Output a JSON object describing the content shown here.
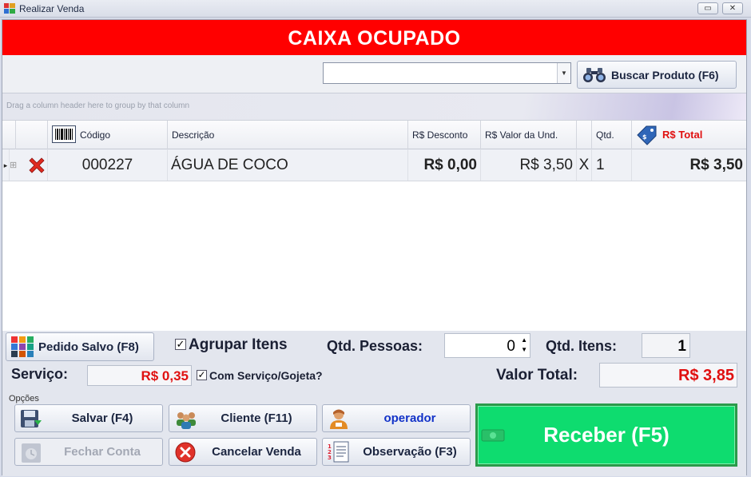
{
  "window": {
    "title": "Realizar Venda",
    "minimize_glyph": "▭",
    "close_glyph": "✕"
  },
  "banner": {
    "text": "CAIXA OCUPADO"
  },
  "search": {
    "value": "",
    "button_label": "Buscar Produto (F6)",
    "button_icon": "binoculars-icon"
  },
  "grid": {
    "group_hint": "Drag a column header here to group by that column",
    "columns": {
      "code": "Código",
      "description": "Descrição",
      "discount": "R$ Desconto",
      "unit_value": "R$ Valor da Und.",
      "qty": "Qtd.",
      "total": "R$ Total"
    },
    "rows": [
      {
        "indicator": "▸",
        "expand": "⊞",
        "code": "000227",
        "description": "ÁGUA DE COCO",
        "discount": "R$ 0,00",
        "unit_value": "R$ 3,50",
        "times": "X",
        "qty": "1",
        "total": "R$ 3,50"
      }
    ]
  },
  "footer": {
    "saved_order_label": "Pedido Salvo (F8)",
    "group_items_label": "Agrupar Itens",
    "group_items_checked": true,
    "people_label": "Qtd. Pessoas:",
    "people_value": "0",
    "items_label": "Qtd. Itens:",
    "items_value": "1",
    "service_label": "Serviço:",
    "service_value": "R$ 0,35",
    "service_check_label": "Com Serviço/Gojeta?",
    "service_checked": true,
    "total_label": "Valor Total:",
    "total_value": "R$ 3,85",
    "options_label": "Opções"
  },
  "buttons": {
    "save": "Salvar (F4)",
    "client": "Cliente (F11)",
    "operator": "operador",
    "close_account": "Fechar Conta",
    "cancel_sale": "Cancelar Venda",
    "observation": "Observação (F3)",
    "receive": "Receber (F5)"
  },
  "colors": {
    "banner": "#ff0000",
    "receive": "#0edc6f",
    "money_red": "#e01010",
    "operator_blue": "#1232c8"
  }
}
